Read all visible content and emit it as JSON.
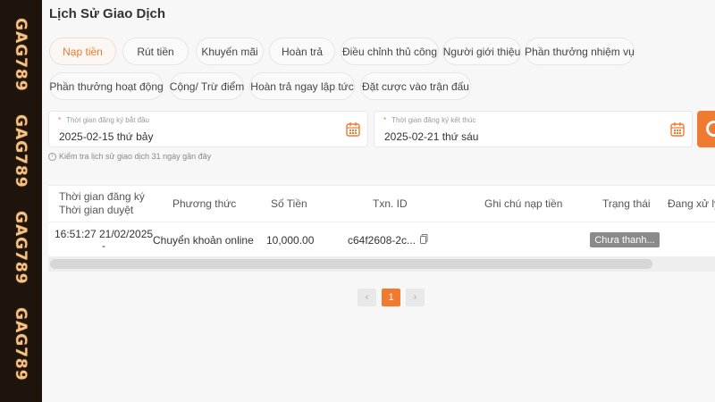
{
  "sidebar": {
    "watermark_text": "GAG789"
  },
  "page": {
    "title": "Lịch Sử Giao Dịch"
  },
  "tabs": [
    {
      "label": "Nạp tiền",
      "active": true
    },
    {
      "label": "Rút tiền"
    },
    {
      "label": "Khuyến mãi"
    },
    {
      "label": "Hoàn trả"
    },
    {
      "label": "Điều chỉnh thủ công"
    },
    {
      "label": "Người giới thiệu"
    },
    {
      "label": "Phần thưởng nhiệm vụ"
    },
    {
      "label": "Phần thưởng hoạt động"
    },
    {
      "label": "Cộng/ Trừ điểm"
    },
    {
      "label": "Hoàn trả ngay lập tức"
    },
    {
      "label": "Đặt cược vào trận đấu"
    }
  ],
  "filters": {
    "start": {
      "label": "Thời gian đăng ký bắt đầu",
      "value": "2025-02-15 thứ bảy"
    },
    "end": {
      "label": "Thời gian đăng ký kết thúc",
      "value": "2025-02-21 thứ sáu"
    },
    "hint": "Kiểm tra lịch sử giao dịch 31 ngày gần đây"
  },
  "table": {
    "headers": {
      "time_line1": "Thời gian đăng ký",
      "time_line2": "Thời gian duyệt",
      "method": "Phương thức",
      "amount": "Số Tiền",
      "txn": "Txn. ID",
      "note": "Ghi chú nạp tiền",
      "status": "Trạng thái",
      "processing": "Đang xử lý"
    },
    "rows": [
      {
        "time_line1": "16:51:27 21/02/2025",
        "time_line2": "-",
        "method": "Chuyển khoản online",
        "amount": "10,000.00",
        "txn": "c64f2608-2c...",
        "status": "Chưa thanh..."
      }
    ]
  },
  "pagination": {
    "current": "1",
    "prev": "‹",
    "next": "›"
  },
  "colors": {
    "accent": "#f07a30",
    "sidebar": "#1e140c",
    "badge": "#8a8a8a"
  }
}
